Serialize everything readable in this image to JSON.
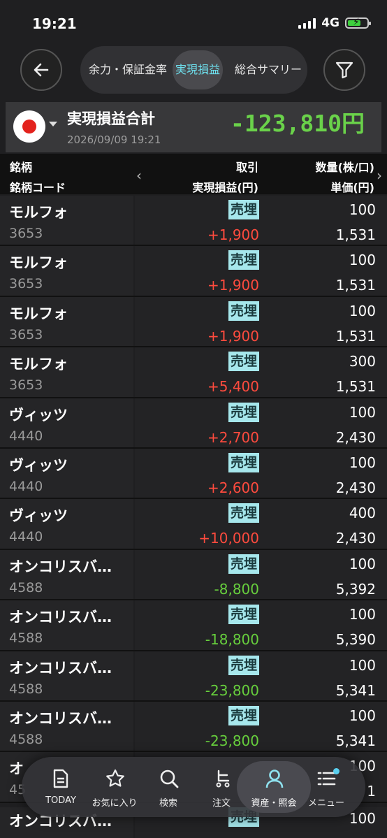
{
  "status": {
    "time": "19:21",
    "network": "4G"
  },
  "header": {
    "tabs": [
      "余力・保証金率",
      "実現損益",
      "総合サマリー"
    ],
    "active_tab": "実現損益"
  },
  "summary": {
    "title": "実現損益合計",
    "date": "2026/09/09 19:21",
    "total": "-123,810円"
  },
  "columns": {
    "col1_line1": "銘柄",
    "col1_line2": "銘柄コード",
    "col2_line1": "取引",
    "col2_line2": "実現損益(円)",
    "col3_line1": "数量(株/口)",
    "col3_line2": "単価(円)"
  },
  "rows": [
    {
      "name": "モルフォ",
      "code": "3653",
      "trade": "売埋",
      "pl": "+1,900",
      "sign": "pos",
      "qty": "100",
      "price": "1,531"
    },
    {
      "name": "モルフォ",
      "code": "3653",
      "trade": "売埋",
      "pl": "+1,900",
      "sign": "pos",
      "qty": "100",
      "price": "1,531"
    },
    {
      "name": "モルフォ",
      "code": "3653",
      "trade": "売埋",
      "pl": "+1,900",
      "sign": "pos",
      "qty": "100",
      "price": "1,531"
    },
    {
      "name": "モルフォ",
      "code": "3653",
      "trade": "売埋",
      "pl": "+5,400",
      "sign": "pos",
      "qty": "300",
      "price": "1,531"
    },
    {
      "name": "ヴィッツ",
      "code": "4440",
      "trade": "売埋",
      "pl": "+2,700",
      "sign": "pos",
      "qty": "100",
      "price": "2,430"
    },
    {
      "name": "ヴィッツ",
      "code": "4440",
      "trade": "売埋",
      "pl": "+2,600",
      "sign": "pos",
      "qty": "100",
      "price": "2,430"
    },
    {
      "name": "ヴィッツ",
      "code": "4440",
      "trade": "売埋",
      "pl": "+10,000",
      "sign": "pos",
      "qty": "400",
      "price": "2,430"
    },
    {
      "name": "オンコリスバ…",
      "code": "4588",
      "trade": "売埋",
      "pl": "-8,800",
      "sign": "neg",
      "qty": "100",
      "price": "5,392"
    },
    {
      "name": "オンコリスバ…",
      "code": "4588",
      "trade": "売埋",
      "pl": "-18,800",
      "sign": "neg",
      "qty": "100",
      "price": "5,390"
    },
    {
      "name": "オンコリスバ…",
      "code": "4588",
      "trade": "売埋",
      "pl": "-23,800",
      "sign": "neg",
      "qty": "100",
      "price": "5,341"
    },
    {
      "name": "オンコリスバ…",
      "code": "4588",
      "trade": "売埋",
      "pl": "-23,800",
      "sign": "neg",
      "qty": "100",
      "price": "5,341"
    },
    {
      "name": "オ",
      "code": "45",
      "trade": "",
      "pl": "",
      "sign": "neg",
      "qty": "100",
      "price": "1"
    }
  ],
  "peek_row": {
    "name": "オンコリスバ…",
    "trade": "売埋",
    "qty": "100"
  },
  "nav": {
    "items": [
      {
        "label": "TODAY",
        "icon": "document-icon"
      },
      {
        "label": "お気に入り",
        "icon": "star-icon"
      },
      {
        "label": "検索",
        "icon": "search-icon"
      },
      {
        "label": "注文",
        "icon": "cart-icon"
      },
      {
        "label": "資産・照会",
        "icon": "person-icon"
      },
      {
        "label": "メニュー",
        "icon": "menu-icon"
      }
    ],
    "active": "資産・照会"
  },
  "colors": {
    "positive": "#ff4b3e",
    "negative": "#67cf3d",
    "total": "#6ad24a",
    "badge": "#a6e7ec",
    "active_tab_text": "#6ee0ee"
  }
}
